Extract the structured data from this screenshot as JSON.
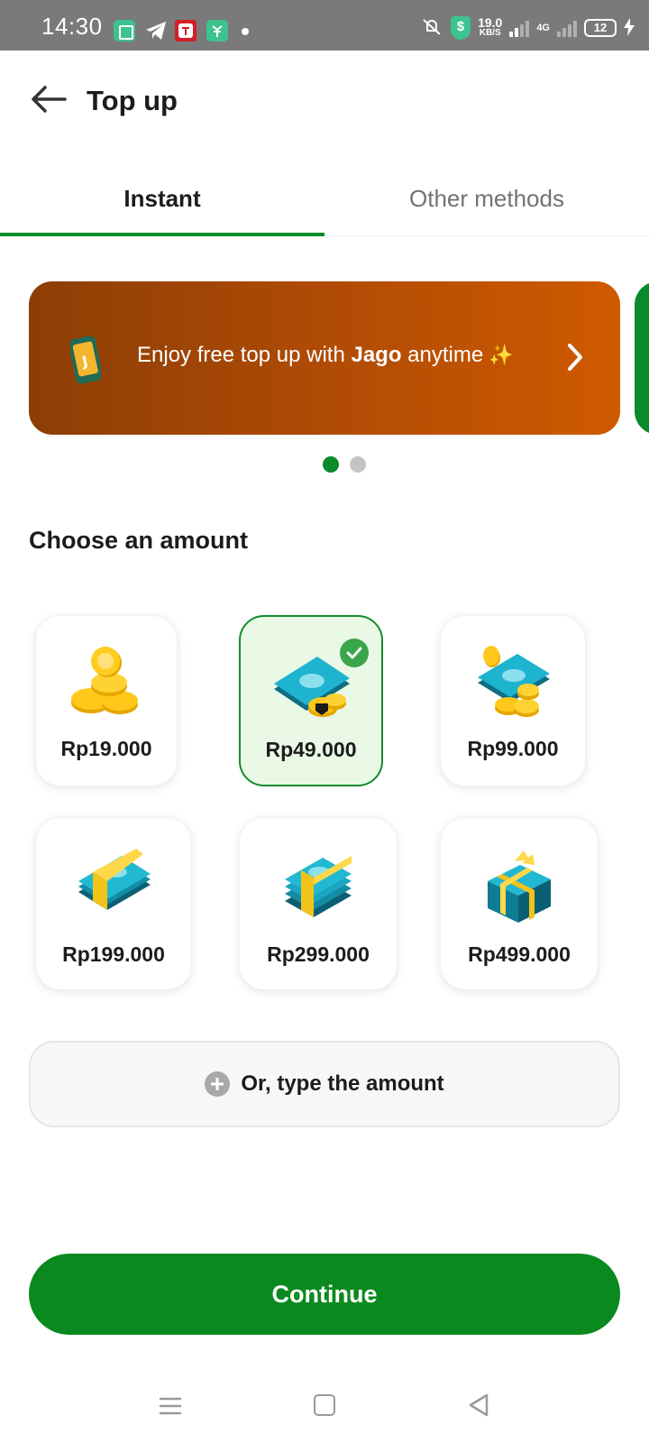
{
  "status_bar": {
    "time": "14:30",
    "speed_value": "19.0",
    "speed_unit": "KB/S",
    "network": "4G",
    "battery": "12"
  },
  "header": {
    "title": "Top up"
  },
  "tabs": [
    {
      "label": "Instant",
      "active": true
    },
    {
      "label": "Other methods",
      "active": false
    }
  ],
  "banner": {
    "text_before": "Enjoy free top up with ",
    "brand": "Jago",
    "text_after": " anytime",
    "phone_letter": "J",
    "page_count": 2,
    "active_page": 1
  },
  "amount_section": {
    "title": "Choose an amount",
    "options": [
      {
        "label": "Rp19.000",
        "icon": "coins-icon",
        "selected": false
      },
      {
        "label": "Rp49.000",
        "icon": "money-coins-icon",
        "selected": true
      },
      {
        "label": "Rp99.000",
        "icon": "money-coins-icon",
        "selected": false
      },
      {
        "label": "Rp199.000",
        "icon": "cash-bundle-icon",
        "selected": false
      },
      {
        "label": "Rp299.000",
        "icon": "cash-stack-icon",
        "selected": false
      },
      {
        "label": "Rp499.000",
        "icon": "cash-gift-stack-icon",
        "selected": false
      }
    ]
  },
  "custom_amount": {
    "label": "Or, type the amount"
  },
  "continue_label": "Continue",
  "colors": {
    "primary_green": "#0a8a1e",
    "banner_start": "#8c3e06",
    "banner_end": "#cf5a00",
    "selected_bg": "#eaf9e6"
  }
}
